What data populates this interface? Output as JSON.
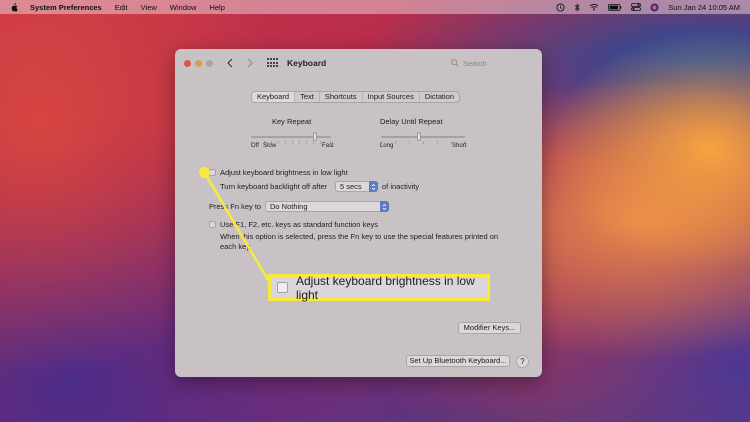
{
  "menubar": {
    "app_name": "System Preferences",
    "items": [
      "Edit",
      "View",
      "Window",
      "Help"
    ],
    "clock": "Sun Jan 24  10:05 AM"
  },
  "window": {
    "title": "Keyboard",
    "search_placeholder": "Search",
    "tabs": [
      "Keyboard",
      "Text",
      "Shortcuts",
      "Input Sources",
      "Dictation"
    ],
    "active_tab": "Keyboard",
    "key_repeat": {
      "label": "Key Repeat",
      "left_end": "Off",
      "left_end2": "Slow",
      "right_end": "Fast",
      "level": 0.8
    },
    "delay_until_repeat": {
      "label": "Delay Until Repeat",
      "left_end": "Long",
      "right_end": "Short",
      "level": 0.45
    },
    "adjust_brightness_label": "Adjust keyboard brightness in low light",
    "backlight_off_label": "Turn keyboard backlight off after",
    "backlight_off_value": "5 secs",
    "backlight_off_suffix": "of inactivity",
    "fn_key_label": "Press Fn key to",
    "fn_key_value": "Do Nothing",
    "fkeys_label": "Use F1, F2, etc. keys as standard function keys",
    "fkeys_note_line1": "When this option is selected, press the Fn key to use the special features printed on",
    "fkeys_note_line2": "each key.",
    "modifier_keys_button": "Modifier Keys...",
    "bluetooth_button": "Set Up Bluetooth Keyboard...",
    "help_button": "?"
  },
  "callout": {
    "text": "Adjust keyboard brightness in low light"
  },
  "colors": {
    "callout_highlight": "#f6ea3d",
    "window_bg": "#c9c2c4",
    "select_chevron": "#5d7bc1"
  }
}
